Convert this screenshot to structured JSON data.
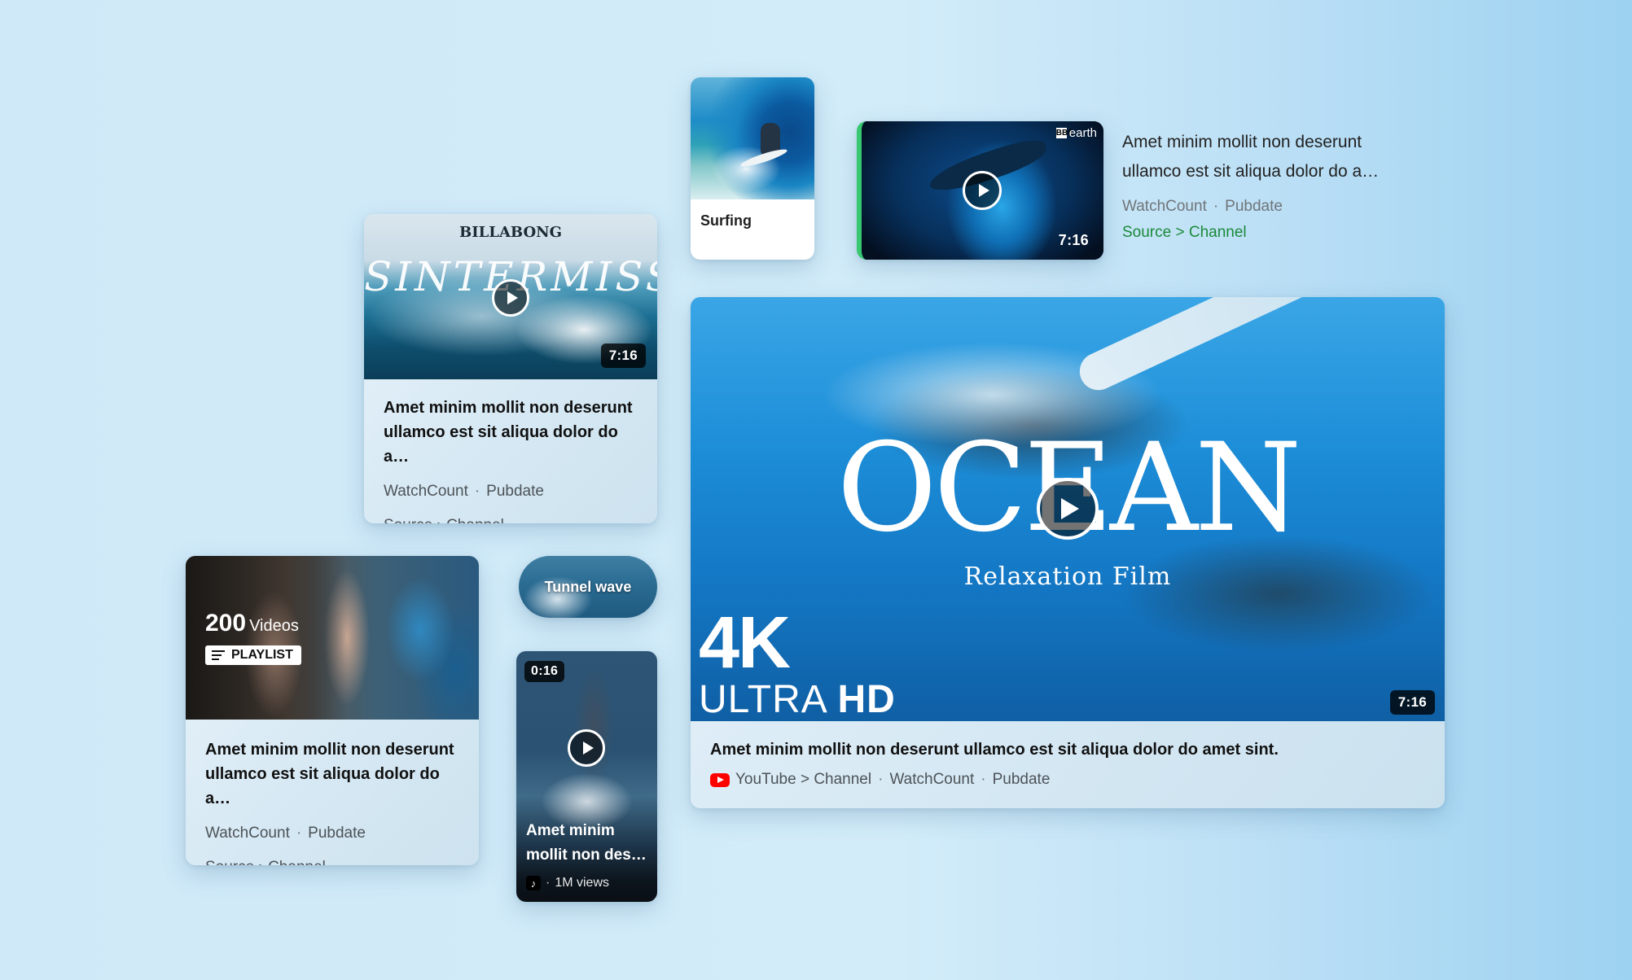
{
  "surf_card": {
    "brand": "BILLABONG",
    "overlay_title": "SINTERMISSION",
    "duration": "7:16",
    "title": "Amet minim mollit non deserunt ullamco est sit aliqua dolor do a…",
    "watch_count": "WatchCount",
    "pub_date": "Pubdate",
    "source_channel": "Source › Channel"
  },
  "surfing_card": {
    "label": "Surfing"
  },
  "bbc_card": {
    "badge_box": "BBC",
    "badge_text": "earth",
    "duration": "7:16",
    "title": "Amet minim mollit non deserunt ullamco est sit aliqua dolor do a…",
    "watch_count": "WatchCount",
    "pub_date": "Pubdate",
    "source_channel": "Source > Channel",
    "accent_color": "#1b8a3a"
  },
  "playlist_card": {
    "count": "200",
    "count_word": "Videos",
    "badge": "PLAYLIST",
    "title": "Amet minim mollit non deserunt ullamco est sit aliqua dolor do a…",
    "watch_count": "WatchCount",
    "pub_date": "Pubdate",
    "source_channel": "Source › Channel"
  },
  "pill_card": {
    "label": "Tunnel wave"
  },
  "short_card": {
    "duration": "0:16",
    "title": "Amet minim mollit non des…",
    "platform_icon": "tiktok-icon",
    "views": "1M views"
  },
  "ocean_card": {
    "overlay_title": "OCEAN",
    "overlay_subtitle": "Relaxation Film",
    "resolution": "4K",
    "ultra": "ULTRA",
    "hd": "HD",
    "duration": "7:16",
    "title": "Amet minim mollit non deserunt ullamco est sit aliqua dolor do amet sint.",
    "source_channel": "YouTube > Channel",
    "watch_count": "WatchCount",
    "pub_date": "Pubdate",
    "platform_icon": "youtube-icon",
    "platform_color": "#ff0000"
  }
}
